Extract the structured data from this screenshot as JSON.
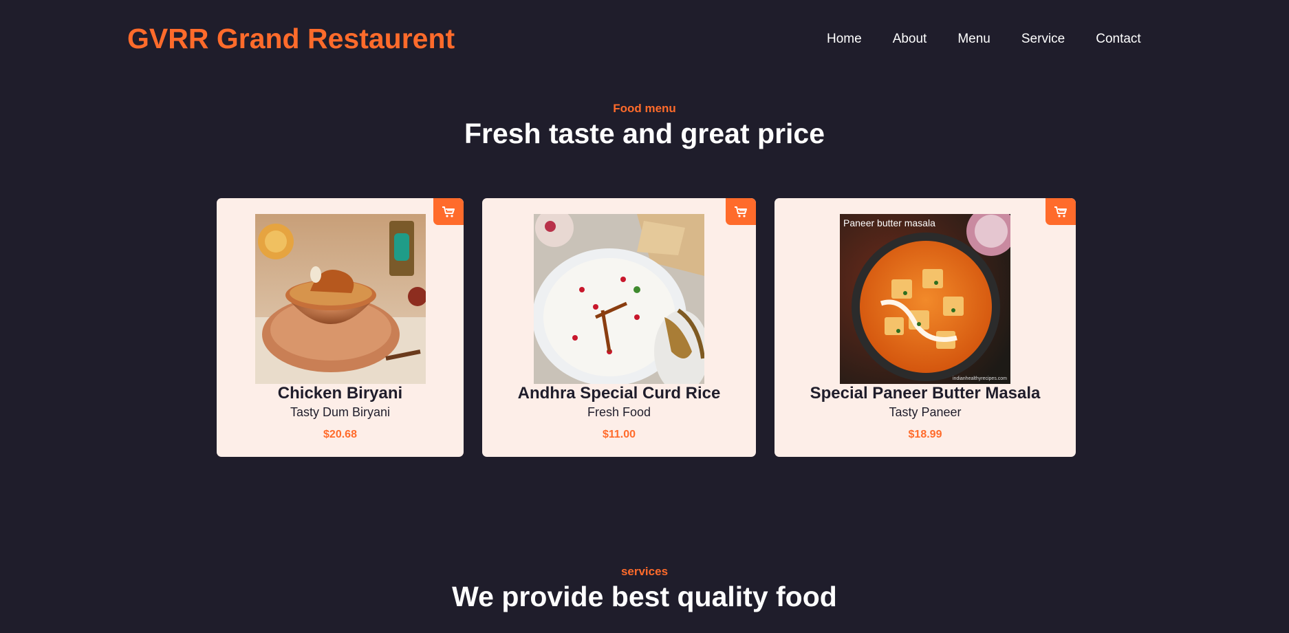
{
  "brand": {
    "name": "GVRR Grand Restaurent"
  },
  "nav": {
    "items": [
      "Home",
      "About",
      "Menu",
      "Service",
      "Contact"
    ]
  },
  "menu_section": {
    "subtitle": "Food menu",
    "title": "Fresh taste and great price"
  },
  "cards": [
    {
      "name": "Chicken Biryani",
      "description": "Tasty Dum Biryani",
      "price": "$20.68",
      "image_icon": "biryani-image"
    },
    {
      "name": "Andhra Special Curd Rice",
      "description": "Fresh Food",
      "price": "$11.00",
      "image_icon": "curd-rice-image"
    },
    {
      "name": "Special Paneer Butter Masala",
      "description": "Tasty Paneer",
      "price": "$18.99",
      "image_icon": "paneer-image",
      "image_caption": "Paneer butter masala",
      "image_credit": "indianhealthyrecipes.com"
    }
  ],
  "services_section": {
    "subtitle": "services",
    "title": "We provide best quality food"
  },
  "colors": {
    "accent": "#ff6b2b",
    "background": "#1f1d2b",
    "card": "#fdeee8"
  }
}
